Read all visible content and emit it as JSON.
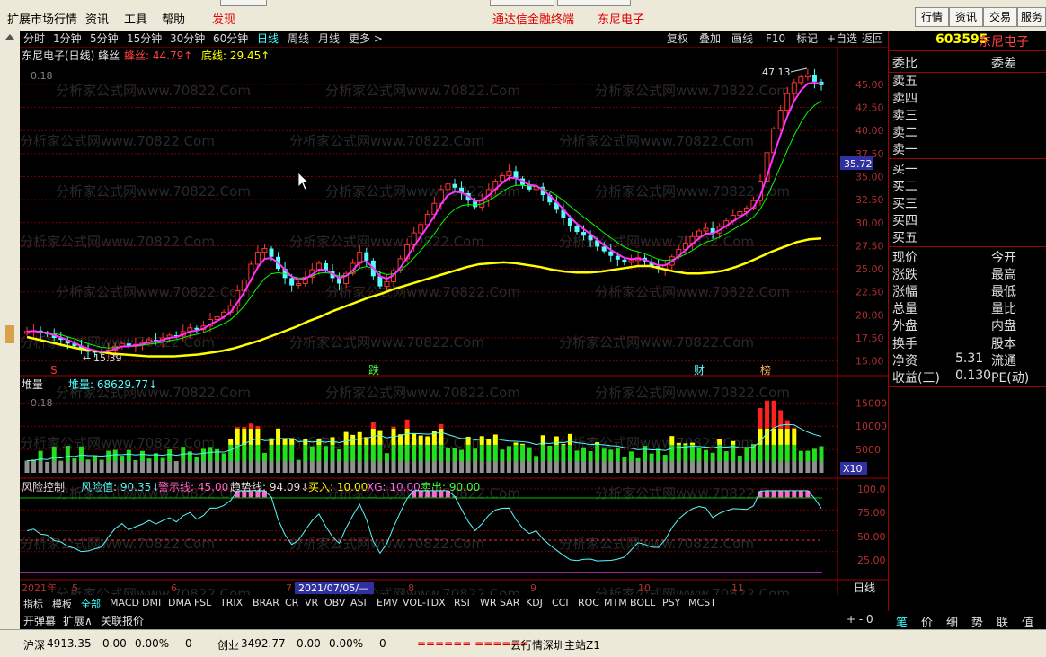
{
  "menu": {
    "items": [
      "扩展市场行情",
      "资讯",
      "工具",
      "帮助",
      "发现"
    ],
    "center_title": "通达信金融终端",
    "center_stock": "东尼电子",
    "right_buttons": [
      "行情",
      "资讯",
      "交易",
      "服务"
    ]
  },
  "periods": {
    "items": [
      "分时",
      "1分钟",
      "5分钟",
      "15分钟",
      "30分钟",
      "60分钟",
      "日线",
      "周线",
      "月线",
      "更多 >"
    ],
    "active": "日线",
    "tools": [
      "复权",
      "叠加",
      "画线",
      "F10",
      "标记",
      "+自选",
      "返回"
    ]
  },
  "stock": {
    "code": "603595",
    "name": "东尼电子",
    "chart_title": "东尼电子(日线) 蜂丝",
    "line1_label": "蜂丝: 44.79↑",
    "line2_label": "底线: 29.45↑",
    "peak_label": "47.13",
    "low_label": "15.39",
    "current_price_tag": "35.72",
    "corner_value": "0.18"
  },
  "markers": {
    "items": [
      "S",
      "跌",
      "财",
      "榜"
    ]
  },
  "volume": {
    "title": "堆量",
    "value_label": "堆量: 68629.77↓",
    "unit_tag": "X10",
    "corner_value": "0.18"
  },
  "risk": {
    "title": "风险控制",
    "labels": [
      "风险值: 90.35↓",
      "警示线: 45.00",
      "趋势线: 94.09↓",
      "买入: 10.00",
      "XG: 10.00",
      "卖出: 90.00"
    ],
    "yticks": [
      "100.0",
      "75.00",
      "50.00",
      "25.00"
    ]
  },
  "time_axis": {
    "labels": [
      "2021年",
      "5",
      "6",
      "7",
      "8",
      "9",
      "10",
      "11"
    ],
    "cursor_date": "2021/07/05/—",
    "period_tag": "日线"
  },
  "indicators": {
    "items": [
      "指标",
      "模板",
      "全部",
      "MACD",
      "DMI",
      "DMA",
      "FSL",
      "TRIX",
      "BRAR",
      "CR",
      "VR",
      "OBV",
      "ASI",
      "EMV",
      "VOL-TDX",
      "RSI",
      "WR",
      "SAR",
      "KDJ",
      "CCI",
      "ROC",
      "MTM",
      "BOLL",
      "PSY",
      "MCST"
    ],
    "sub": [
      "开弹幕",
      "扩展∧",
      "关联报价"
    ]
  },
  "right_panel": {
    "header": [
      "委比",
      "委差"
    ],
    "sells": [
      "卖五",
      "卖四",
      "卖三",
      "卖二",
      "卖一"
    ],
    "buys": [
      "买一",
      "买二",
      "买三",
      "买四",
      "买五"
    ],
    "quote_left": [
      "现价",
      "涨跌",
      "涨幅",
      "总量",
      "外盘"
    ],
    "quote_right": [
      "今开",
      "最高",
      "最低",
      "量比",
      "内盘"
    ],
    "fin_left": [
      "换手",
      "净资",
      "收益(三)"
    ],
    "fin_values": [
      "",
      "5.31",
      "0.130"
    ],
    "fin_right": [
      "股本",
      "流通",
      "PE(动)"
    ],
    "tabs": [
      "笔",
      "价",
      "细",
      "势",
      "联",
      "值"
    ]
  },
  "status": {
    "sh_label": "沪深",
    "sh_value": "4913.35",
    "sh_change": "0.00",
    "sh_pct": "0.00%",
    "sh_vol": "0",
    "cy_label": "创业",
    "cy_value": "3492.77",
    "cy_change": "0.00",
    "cy_pct": "0.00%",
    "cy_vol": "0",
    "server": "云行情深圳主站Z1"
  },
  "watermark": "分析家公式网www.70822.Com",
  "colors": {
    "up": "#ff3232",
    "down": "#54fcfc",
    "ma_fast": "#ff33ff",
    "ma_slow": "#ffff00",
    "ma_mid": "#00ff00",
    "risk_line": "#54fcfc",
    "warn_line": "#ff66cc"
  },
  "chart_data": {
    "type": "line",
    "price_yticks": [
      45.0,
      42.5,
      40.0,
      37.5,
      35.0,
      32.5,
      30.0,
      27.5,
      25.0,
      22.5,
      20.0,
      17.5,
      15.0
    ],
    "volume_yticks": [
      15000,
      10000,
      5000
    ],
    "ylim": [
      13.8,
      48.5
    ],
    "closes": [
      18.2,
      18.3,
      18.0,
      17.9,
      17.5,
      17.3,
      16.9,
      16.6,
      16.2,
      16.0,
      15.9,
      15.8,
      16.2,
      16.6,
      16.9,
      16.6,
      16.8,
      17.0,
      17.3,
      17.2,
      17.5,
      17.8,
      17.7,
      18.2,
      18.6,
      18.4,
      18.8,
      19.5,
      19.8,
      20.3,
      21.0,
      22.6,
      23.8,
      25.5,
      26.8,
      27.2,
      26.3,
      25.0,
      24.0,
      23.2,
      23.4,
      24.1,
      24.9,
      25.6,
      24.8,
      24.0,
      23.4,
      24.5,
      25.6,
      26.8,
      25.9,
      24.2,
      23.1,
      23.6,
      24.8,
      26.1,
      27.6,
      28.9,
      29.8,
      30.9,
      32.1,
      33.6,
      34.2,
      33.8,
      33.2,
      32.4,
      31.7,
      32.5,
      33.6,
      34.5,
      35.1,
      35.6,
      34.8,
      34.1,
      33.6,
      33.9,
      33.0,
      32.2,
      31.4,
      30.5,
      29.6,
      29.0,
      28.6,
      28.1,
      27.4,
      26.9,
      26.4,
      26.0,
      25.7,
      25.9,
      26.2,
      25.8,
      25.3,
      25.0,
      25.4,
      26.3,
      27.1,
      27.8,
      28.5,
      29.1,
      29.4,
      28.9,
      29.6,
      30.2,
      30.8,
      31.2,
      31.6,
      32.4,
      34.5,
      37.6,
      40.2,
      42.2,
      44.0,
      45.2,
      45.8,
      46.0,
      45.3,
      44.9
    ],
    "slow_ma": [
      17.6,
      17.3,
      17.0,
      16.7,
      16.4,
      16.2,
      16.0,
      15.8,
      15.7,
      15.6,
      15.5,
      15.5,
      15.5,
      15.6,
      15.7,
      15.9,
      16.1,
      16.4,
      16.8,
      17.2,
      17.7,
      18.2,
      18.7,
      19.3,
      19.8,
      20.4,
      20.9,
      21.4,
      21.9,
      22.3,
      22.8,
      23.2,
      23.6,
      24.0,
      24.4,
      24.8,
      25.2,
      25.5,
      25.6,
      25.7,
      25.6,
      25.4,
      25.2,
      24.9,
      24.7,
      24.6,
      24.6,
      24.7,
      24.9,
      25.1,
      25.3,
      25.3,
      25.0,
      24.7,
      24.5,
      24.5,
      24.6,
      24.8,
      25.2,
      25.7,
      26.3,
      26.9,
      27.4,
      27.9,
      28.2,
      28.3
    ]
  }
}
